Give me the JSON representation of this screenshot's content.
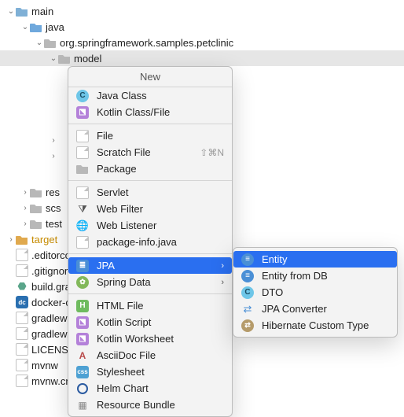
{
  "tree": {
    "main": "main",
    "java": "java",
    "pkg": "org.springframework.samples.petclinic",
    "model": "model",
    "res": "res",
    "scs": "scs",
    "test": "test",
    "target": "target",
    "editorconfig": ".editorco",
    "gitignore": ".gitignore",
    "buildgradle": "build.gra",
    "dockerc": "docker-c",
    "gradlew": "gradlew",
    "gradlewbat": "gradlew.",
    "license": "LICENSE",
    "mvnw": "mvnw",
    "mvnwcmd": "mvnw.cm"
  },
  "menu": {
    "title": "New",
    "items": {
      "javaClass": "Java Class",
      "kotlinClassFile": "Kotlin Class/File",
      "file": "File",
      "scratchFile": "Scratch File",
      "scratchShortcut": "⇧⌘N",
      "package": "Package",
      "servlet": "Servlet",
      "webFilter": "Web Filter",
      "webListener": "Web Listener",
      "packageInfo": "package-info.java",
      "jpa": "JPA",
      "springData": "Spring Data",
      "htmlFile": "HTML File",
      "kotlinScript": "Kotlin Script",
      "kotlinWorksheet": "Kotlin Worksheet",
      "asciidoc": "AsciiDoc File",
      "stylesheet": "Stylesheet",
      "helmChart": "Helm Chart",
      "resourceBundle": "Resource Bundle"
    }
  },
  "submenu": {
    "entity": "Entity",
    "entityFromDb": "Entity from DB",
    "dto": "DTO",
    "jpaConverter": "JPA Converter",
    "hibernateCustomType": "Hibernate Custom Type"
  }
}
